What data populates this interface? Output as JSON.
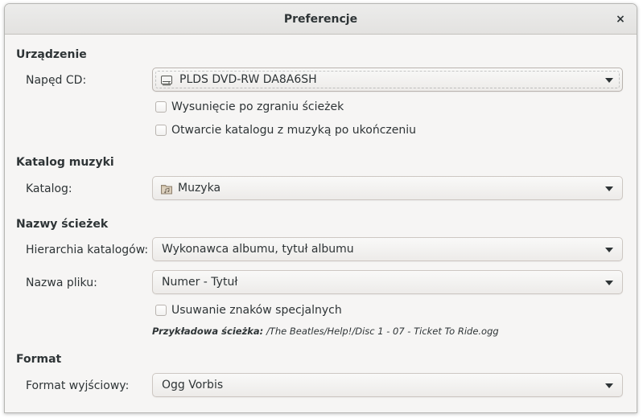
{
  "window": {
    "title": "Preferencje",
    "close_glyph": "×"
  },
  "device": {
    "section_title": "Urządzenie",
    "drive_label": "Napęd CD:",
    "drive_value": "PLDS DVD-RW DA8A6SH",
    "drive_icon": "optical-drive-icon",
    "eject_label": "Wysunięcie po zgraniu ścieżek",
    "eject_checked": false,
    "open_folder_label": "Otwarcie katalogu z muzyką po ukończeniu",
    "open_folder_checked": false
  },
  "music_folder": {
    "section_title": "Katalog muzyki",
    "folder_label": "Katalog:",
    "folder_value": "Muzyka",
    "folder_icon": "music-folder-icon"
  },
  "track_names": {
    "section_title": "Nazwy ścieżek",
    "hierarchy_label": "Hierarchia katalogów:",
    "hierarchy_value": "Wykonawca albumu, tytuł albumu",
    "filename_label": "Nazwa pliku:",
    "filename_value": "Numer - Tytuł",
    "strip_label": "Usuwanie znaków specjalnych",
    "strip_checked": false,
    "example_prefix": "Przykładowa ścieżka:",
    "example_path": "/The Beatles/Help!/Disc 1 - 07 - Ticket To Ride.ogg"
  },
  "format": {
    "section_title": "Format",
    "output_label": "Format wyjściowy:",
    "output_value": "Ogg Vorbis"
  }
}
